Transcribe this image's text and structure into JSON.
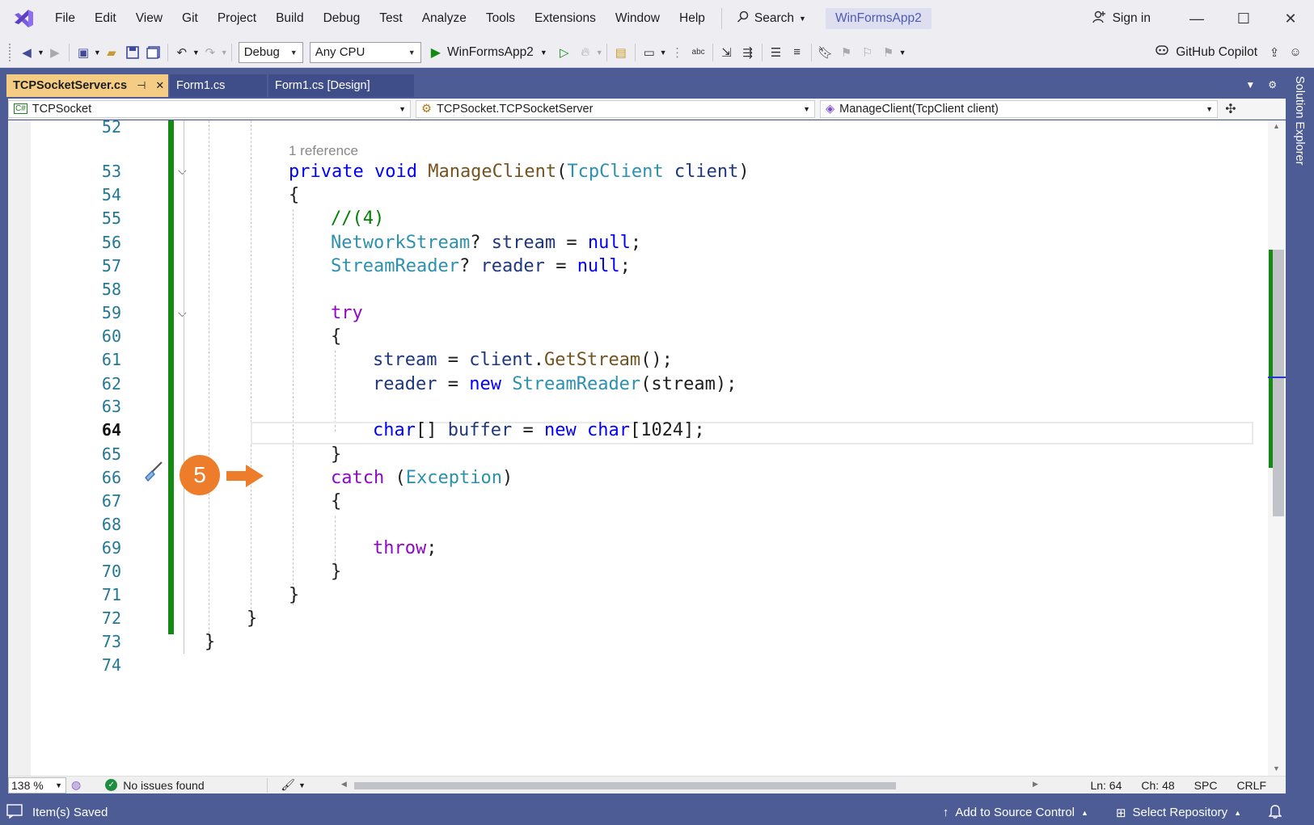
{
  "menu": {
    "items": [
      "File",
      "Edit",
      "View",
      "Git",
      "Project",
      "Build",
      "Debug",
      "Test",
      "Analyze",
      "Tools",
      "Extensions",
      "Window",
      "Help"
    ],
    "search_label": "Search",
    "solution_name": "WinFormsApp2",
    "sign_in": "Sign in"
  },
  "toolbar": {
    "config": "Debug",
    "platform": "Any CPU",
    "startup_project": "WinFormsApp2",
    "copilot_label": "GitHub Copilot"
  },
  "tabs": [
    {
      "label": "TCPSocketServer.cs",
      "active": true
    },
    {
      "label": "Form1.cs",
      "active": false
    },
    {
      "label": "Form1.cs [Design]",
      "active": false
    }
  ],
  "navbar": {
    "project": "TCPSocket",
    "type": "TCPSocket.TCPSocketServer",
    "member": "ManageClient(TcpClient client)"
  },
  "editor": {
    "line_numbers": [
      "52",
      "53",
      "54",
      "55",
      "56",
      "57",
      "58",
      "59",
      "60",
      "61",
      "62",
      "63",
      "64",
      "65",
      "66",
      "67",
      "68",
      "69",
      "70",
      "71",
      "72",
      "73",
      "74"
    ],
    "current_line": "64",
    "reference_lens": "1 reference",
    "code_lines": {
      "l53": [
        "private",
        "void",
        "ManageClient",
        "(",
        "TcpClient",
        "client",
        ")"
      ],
      "l54": "{",
      "l55": "//(4)",
      "l56": [
        "NetworkStream",
        "?",
        "stream",
        "=",
        "null",
        ";"
      ],
      "l57": [
        "StreamReader",
        "?",
        "reader",
        "=",
        "null",
        ";"
      ],
      "l59": "try",
      "l60": "{",
      "l61": [
        "stream",
        "=",
        "client",
        ".",
        "GetStream",
        "();"
      ],
      "l62": [
        "reader",
        "=",
        "new",
        "StreamReader",
        "(stream);"
      ],
      "l64": [
        "char",
        "[]",
        "buffer",
        "=",
        "new",
        "char",
        "[1024];"
      ],
      "l65": "}",
      "l66": [
        "catch",
        "(",
        "Exception",
        ")"
      ],
      "l67": "{",
      "l69": [
        "throw",
        ";"
      ],
      "l70": "}",
      "l71": "}",
      "l72": "}",
      "l73": "}"
    },
    "step_badge": "5"
  },
  "editor_status": {
    "zoom": "138 %",
    "health": "No issues found",
    "line": "Ln: 64",
    "col": "Ch: 48",
    "whitespace": "SPC",
    "line_ending": "CRLF"
  },
  "side_panel": {
    "label": "Solution Explorer"
  },
  "statusbar": {
    "message": "Item(s) Saved",
    "source_control": "Add to Source Control",
    "repository": "Select Repository"
  },
  "colors": {
    "accent": "#4d5c95",
    "active_tab": "#f5cc84",
    "change_bar": "#138b13",
    "badge": "#ee7d2b",
    "keyword": "#0000ff",
    "control_keyword": "#8f08c4",
    "type": "#2b91af",
    "method": "#74531f",
    "variable": "#1f377f",
    "comment": "#008000"
  }
}
